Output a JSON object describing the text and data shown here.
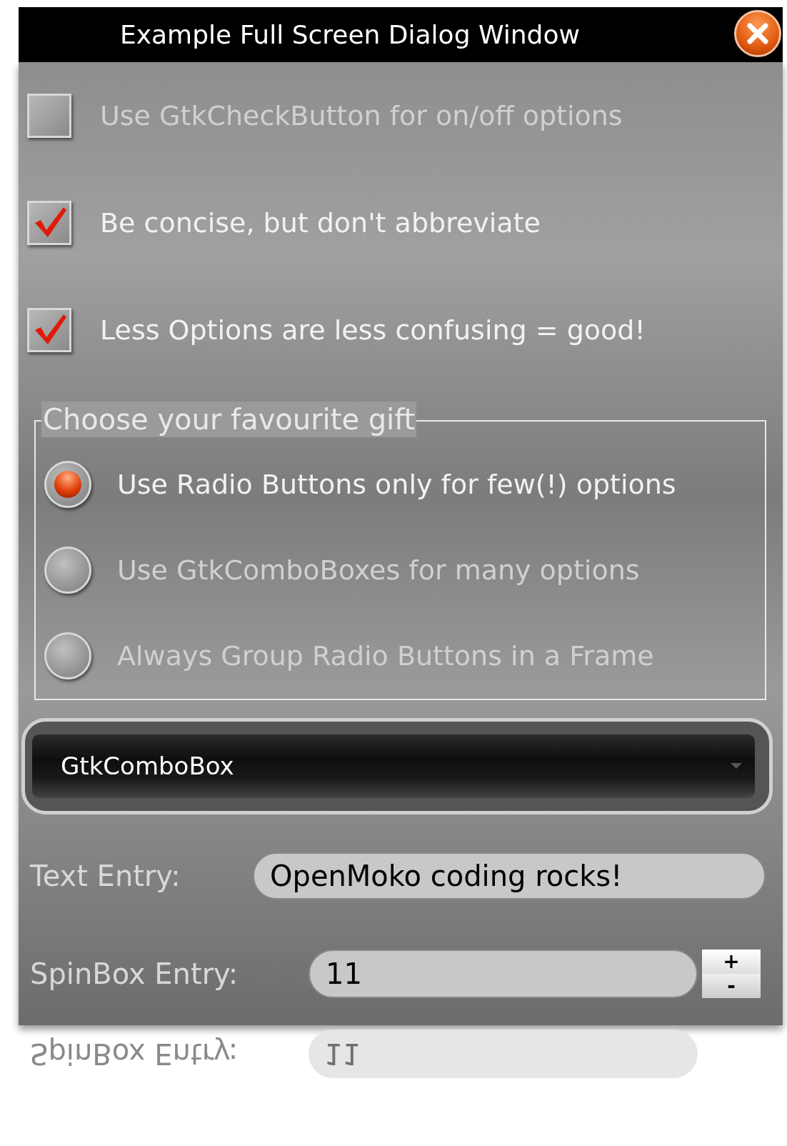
{
  "window": {
    "title": "Example Full Screen Dialog Window"
  },
  "checkboxes": [
    {
      "label": "Use GtkCheckButton for on/off options",
      "checked": false
    },
    {
      "label": "Be concise, but don't abbreviate",
      "checked": true
    },
    {
      "label": "Less Options are less confusing = good!",
      "checked": true
    }
  ],
  "frame": {
    "title": "Choose your favourite gift",
    "options": [
      {
        "label": "Use Radio Buttons only for few(!) options",
        "selected": true
      },
      {
        "label": "Use GtkComboBoxes for many options",
        "selected": false
      },
      {
        "label": "Always Group Radio Buttons in a Frame",
        "selected": false
      }
    ]
  },
  "combo": {
    "value": "GtkComboBox"
  },
  "text_entry": {
    "label": "Text Entry:",
    "value": "OpenMoko coding rocks!"
  },
  "spin_entry": {
    "label": "SpinBox Entry:",
    "value": "11",
    "increment": "+",
    "decrement": "-"
  },
  "reflection": {
    "label": "SpinBox Entry:",
    "value": "11"
  }
}
